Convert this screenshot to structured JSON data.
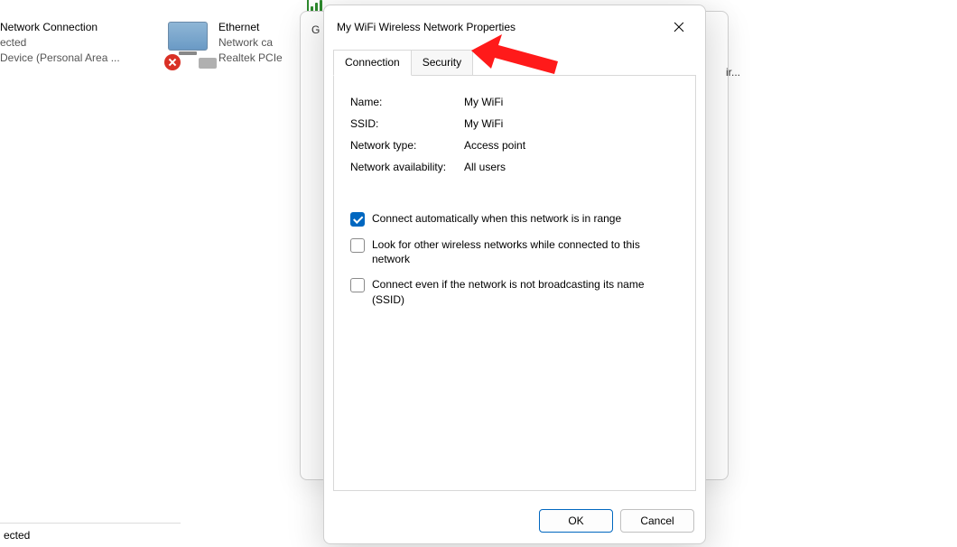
{
  "background": {
    "item1": {
      "title": "Network Connection",
      "line2": "ected",
      "line3": "Device (Personal Area ..."
    },
    "item2": {
      "title": "Ethernet",
      "line2": "Network ca",
      "line3": "Realtek PCIe"
    },
    "behind_letter": "G",
    "partial_right": "ir...",
    "status_bottom": "ected"
  },
  "dialog": {
    "title": "My WiFi Wireless Network Properties",
    "tabs": {
      "connection": "Connection",
      "security": "Security"
    },
    "fields": {
      "name_label": "Name:",
      "name_value": "My WiFi",
      "ssid_label": "SSID:",
      "ssid_value": "My WiFi",
      "type_label": "Network type:",
      "type_value": "Access point",
      "avail_label": "Network availability:",
      "avail_value": "All users"
    },
    "checkboxes": {
      "auto_connect": {
        "label": "Connect automatically when this network is in range",
        "checked": true
      },
      "look_other": {
        "label": "Look for other wireless networks while connected to this network",
        "checked": false
      },
      "connect_hidden": {
        "label": "Connect even if the network is not broadcasting its name (SSID)",
        "checked": false
      }
    },
    "buttons": {
      "ok": "OK",
      "cancel": "Cancel"
    }
  }
}
